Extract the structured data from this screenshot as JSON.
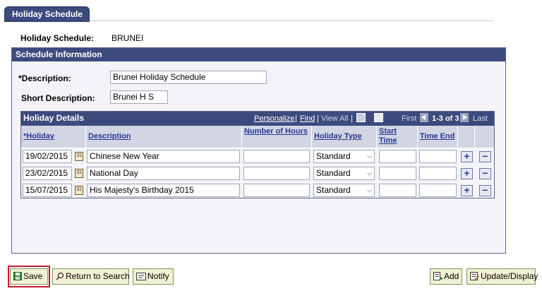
{
  "tab": {
    "label": "Holiday Schedule"
  },
  "header": {
    "schedule_label": "Holiday Schedule:",
    "schedule_value": "BRUNEI"
  },
  "schedule_info": {
    "title": "Schedule Information",
    "description_label": "*Description:",
    "description_value": "Brunei Holiday Schedule",
    "short_desc_label": "Short Description:",
    "short_desc_value": "Brunei H S"
  },
  "grid": {
    "title": "Holiday Details",
    "personalize": "Personalize",
    "find": "Find",
    "view_all": "View All",
    "first": "First",
    "range": "1-3 of 3",
    "last": "Last",
    "columns": {
      "holiday": "*Holiday",
      "description": "Description",
      "hours": "Number of Hours",
      "type": "Holiday Type",
      "start": "Start Time",
      "end": "Time End"
    },
    "rows": [
      {
        "date": "19/02/2015",
        "description": "Chinese New Year",
        "hours": "",
        "type": "Standard",
        "start": "",
        "end": ""
      },
      {
        "date": "23/02/2015",
        "description": "National Day",
        "hours": "",
        "type": "Standard",
        "start": "",
        "end": ""
      },
      {
        "date": "15/07/2015",
        "description": "His Majesty's Birthday 2015",
        "hours": "",
        "type": "Standard",
        "start": "",
        "end": ""
      }
    ]
  },
  "toolbar": {
    "save": "Save",
    "return_to_search": "Return to Search",
    "notify": "Notify",
    "add": "Add",
    "update_display": "Update/Display"
  },
  "icons": {
    "calendar": "calendar-icon",
    "add_row": "plus-icon",
    "delete_row": "minus-icon",
    "zoom": "zoom-icon",
    "grid_toggle": "grid-icon"
  },
  "colors": {
    "header_blue": "#3d4a7e",
    "link_blue": "#2a3a94",
    "button_bg": "#f1f1d3",
    "highlight_red": "#c0182c"
  }
}
